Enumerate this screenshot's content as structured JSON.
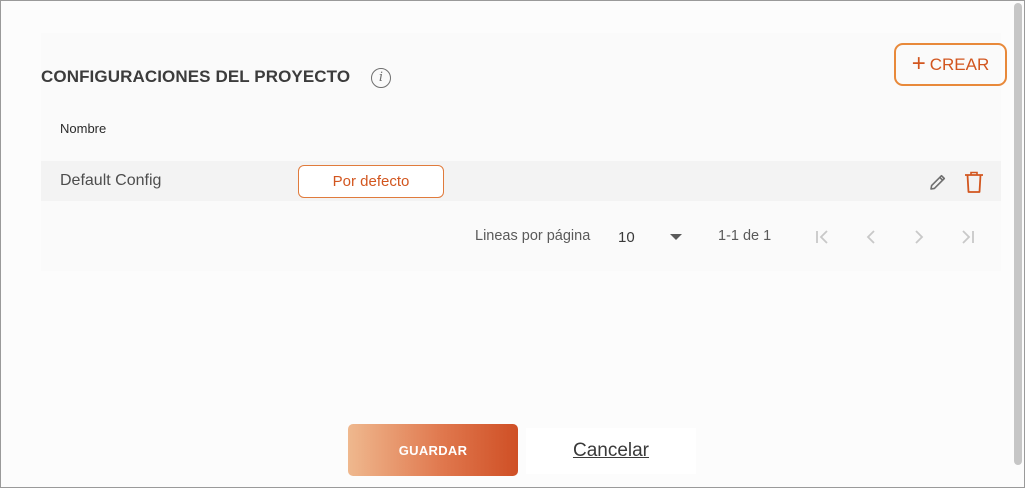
{
  "section": {
    "title": "CONFIGURACIONES DEL PROYECTO",
    "info_icon": "i",
    "create_button": {
      "icon": "plus-icon",
      "label": "CREAR"
    }
  },
  "table": {
    "columns": [
      "Nombre"
    ],
    "rows": [
      {
        "name": "Default Config",
        "badge": "Por defecto",
        "actions": [
          "pencil-icon",
          "trash-icon"
        ]
      }
    ]
  },
  "pagination": {
    "rows_per_page_label": "Lineas por página",
    "rows_per_page_value": "10",
    "range_label": "1-1 de 1",
    "controls": [
      "first-page-icon",
      "previous-page-icon",
      "next-page-icon",
      "last-page-icon"
    ]
  },
  "footer": {
    "save_label": "GUARDAR",
    "cancel_label": "Cancelar"
  },
  "colors": {
    "accent": "#d2561f",
    "accent_border": "#e8893a",
    "icon_gray": "#6f6f6f",
    "disabled_gray": "#c8c8c8"
  }
}
